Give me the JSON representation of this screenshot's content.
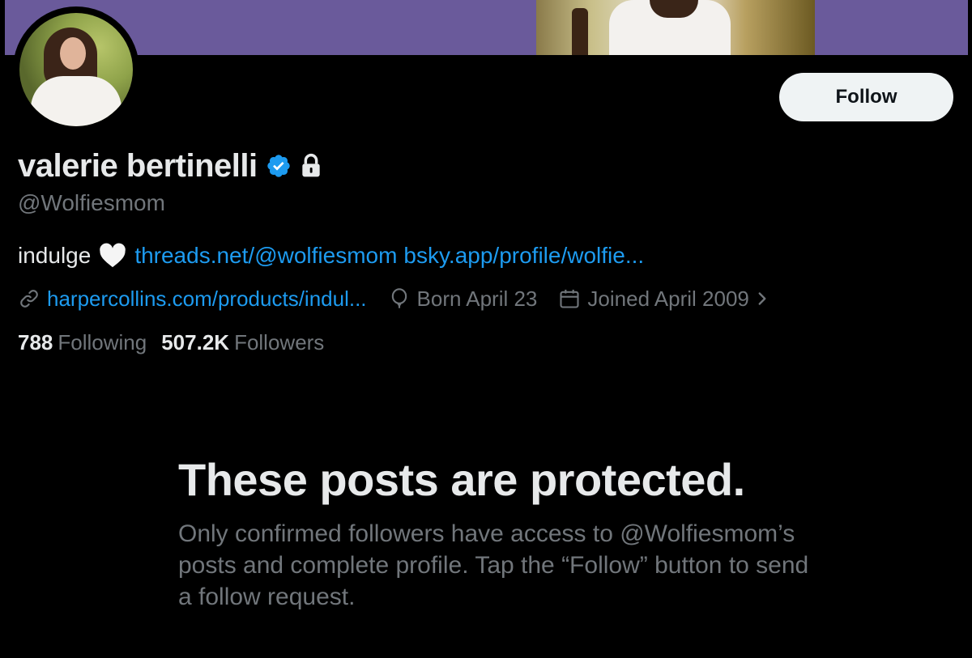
{
  "profile": {
    "display_name": "valerie bertinelli",
    "handle": "@Wolfiesmom",
    "follow_label": "Follow",
    "bio": {
      "text": "indulge",
      "link1": "threads.net/@wolfiesmom",
      "link2": "bsky.app/profile/wolfie..."
    },
    "meta": {
      "website": "harpercollins.com/products/indul...",
      "birthday": "Born April 23",
      "joined": "Joined April 2009"
    },
    "stats": {
      "following_count": "788",
      "following_label": "Following",
      "followers_count": "507.2K",
      "followers_label": "Followers"
    }
  },
  "protected_notice": {
    "title": "These posts are protected.",
    "body": "Only confirmed followers have access to @Wolfiesmom’s posts and complete profile. Tap the “Follow” button to send a follow request."
  },
  "colors": {
    "background": "#000000",
    "banner": "#6a5a9b",
    "link": "#1d9bf0",
    "secondary_text": "#71767b",
    "primary_text": "#e7e9ea",
    "verified": "#1d9bf0",
    "follow_button_bg": "#eff3f4"
  },
  "icons": {
    "verified": "verified-badge-icon",
    "lock": "lock-icon",
    "heart": "white-heart-icon",
    "link": "link-icon",
    "birthday": "balloon-icon",
    "joined": "calendar-icon",
    "chevron": "chevron-right-icon"
  }
}
